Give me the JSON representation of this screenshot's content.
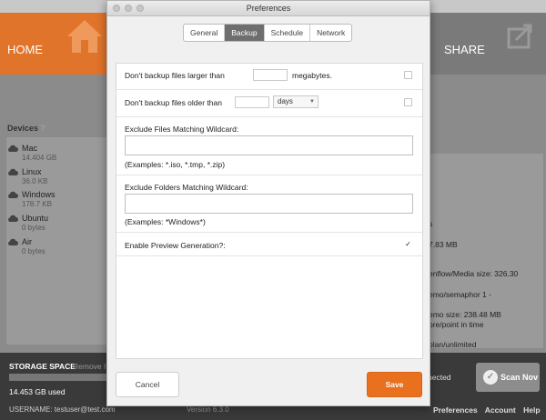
{
  "app": {
    "nav": {
      "home_label": "HOME",
      "share_label": "SHARE"
    },
    "devices": {
      "title": "Devices",
      "help": "?",
      "items": [
        {
          "name": "Mac",
          "size": "14.404 GB"
        },
        {
          "name": "Linux",
          "size": "36.0 KB"
        },
        {
          "name": "Windows",
          "size": "178.7 KB"
        },
        {
          "name": "Ubuntu",
          "size": "0 bytes"
        },
        {
          "name": "Air",
          "size": "0 bytes"
        }
      ]
    },
    "info_lines": [
      "s",
      "7.83 MB",
      "enflow/Media size: 326.30",
      "emo/semaphor 1 -",
      "emo size: 238.48 MB",
      "ore/point in time",
      "olan/unlimited"
    ],
    "footer": {
      "storage_label": "STORAGE SPACE",
      "remove_label": "Remove I",
      "storage_used": "14.453 GB used",
      "username": "USERNAME: testuser@test.com",
      "version": "Version 6.3.0",
      "connected": "nected",
      "scan_label": "Scan Nov",
      "links": [
        "Preferences",
        "Account",
        "Help"
      ]
    }
  },
  "dialog": {
    "title": "Preferences",
    "tabs": [
      "General",
      "Backup",
      "Schedule",
      "Network"
    ],
    "active_tab": "Backup",
    "backup": {
      "size_limit": {
        "label": "Don't backup files larger than",
        "value": "",
        "unit": "megabytes.",
        "checked": false
      },
      "age_limit": {
        "label": "Don't backup files older than",
        "value": "",
        "unit": "days",
        "checked": false
      },
      "exclude_files": {
        "label": "Exclude Files Matching Wildcard:",
        "value": "",
        "examples": "(Examples:  *.iso, *.tmp, *.zip)"
      },
      "exclude_folders": {
        "label": "Exclude Folders Matching Wildcard:",
        "value": "",
        "examples": "(Examples:  *Windows*)"
      },
      "preview": {
        "label": "Enable Preview Generation?:",
        "checked": true
      }
    },
    "buttons": {
      "cancel": "Cancel",
      "save": "Save"
    }
  },
  "colors": {
    "accent": "#e8701e",
    "home_tab": "#e0742a",
    "active_tab": "#6e6e6e"
  },
  "icons": [
    "house-icon",
    "share-icon",
    "cloud-icon",
    "check-circle-icon",
    "chevron-down-icon",
    "checkmark-icon"
  ]
}
